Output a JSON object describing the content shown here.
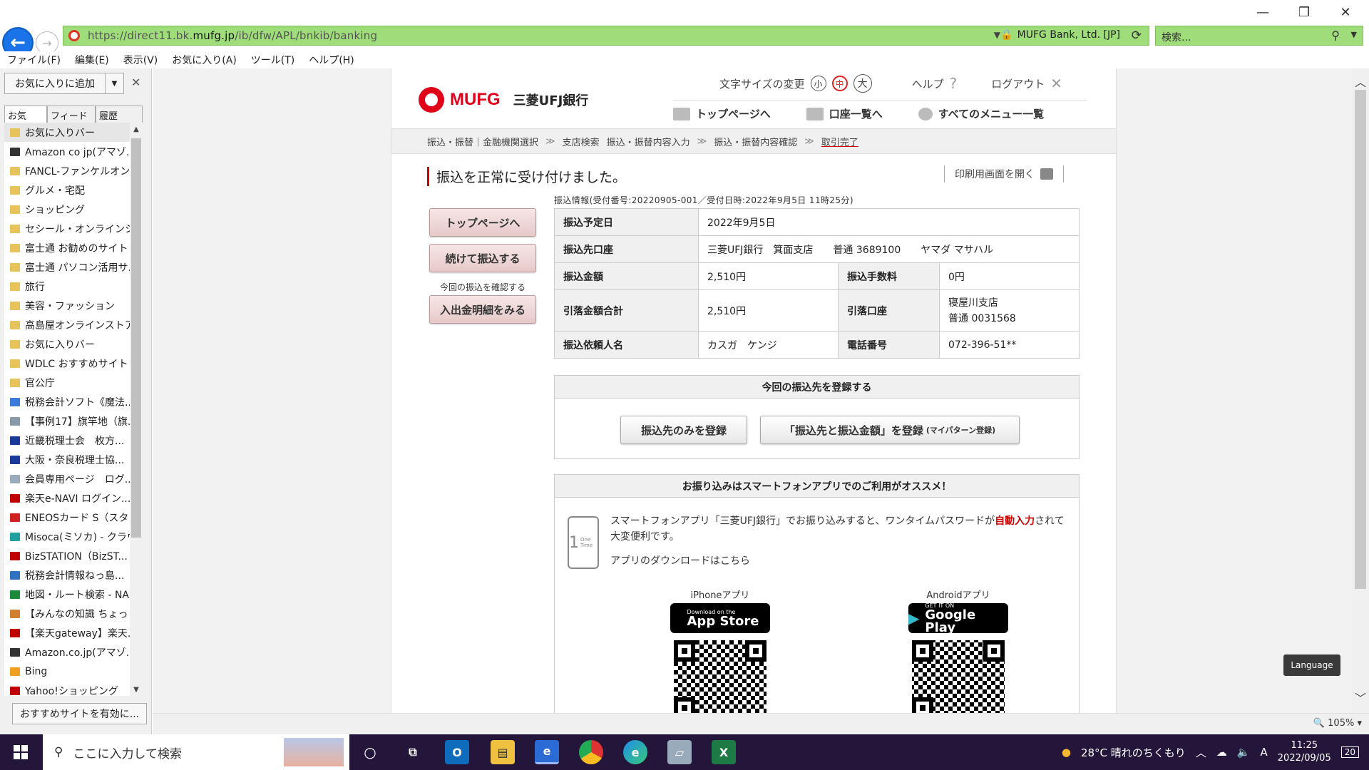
{
  "browser": {
    "url_prefix": "https://direct11.bk.",
    "url_domain": "mufg.jp",
    "url_path": "/ib/dfw/APL/bnkib/banking",
    "cert_label": "MUFG Bank, Ltd. [JP]",
    "search_placeholder": "検索...",
    "menu": [
      "ファイル(F)",
      "編集(E)",
      "表示(V)",
      "お気に入り(A)",
      "ツール(T)",
      "ヘルプ(H)"
    ]
  },
  "favorites": {
    "add_button": "お気に入りに追加",
    "tabs": [
      "お気に...",
      "フィード",
      "履歴"
    ],
    "items": [
      {
        "label": "お気に入りバー",
        "color": "#e8c25a"
      },
      {
        "label": "Amazon co jp(アマゾ...",
        "color": "#333333"
      },
      {
        "label": "FANCL-ファンケルオンラ...",
        "color": "#e8c25a"
      },
      {
        "label": "グルメ・宅配",
        "color": "#e8c25a"
      },
      {
        "label": "ショッピング",
        "color": "#e8c25a"
      },
      {
        "label": "セシール・オンラインショ...",
        "color": "#e8c25a"
      },
      {
        "label": "富士通 お勧めのサイト",
        "color": "#e8c25a"
      },
      {
        "label": "富士通 パソコン活用サ...",
        "color": "#e8c25a"
      },
      {
        "label": "旅行",
        "color": "#e8c25a"
      },
      {
        "label": "美容・ファッション",
        "color": "#e8c25a"
      },
      {
        "label": "高島屋オンラインストア",
        "color": "#e8c25a"
      },
      {
        "label": "お気に入りバー",
        "color": "#e8c25a"
      },
      {
        "label": "WDLC おすすめサイト",
        "color": "#e8c25a"
      },
      {
        "label": "官公庁",
        "color": "#e8c25a"
      },
      {
        "label": "税務会計ソフト《魔法...",
        "color": "#3a7ad8"
      },
      {
        "label": "【事例17】旗竿地（旗...",
        "color": "#8899aa"
      },
      {
        "label": "近畿税理士会　枚方...",
        "color": "#1a3a9a"
      },
      {
        "label": "大阪・奈良税理士協...",
        "color": "#1a3a9a"
      },
      {
        "label": "会員専用ページ　ログ...",
        "color": "#99aabb"
      },
      {
        "label": "楽天e-NAVI ログイン...",
        "color": "#c00000"
      },
      {
        "label": "ENEOSカード S（スタ...",
        "color": "#d02020"
      },
      {
        "label": "Misoca(ミソカ) - クラウ...",
        "color": "#20a0a0"
      },
      {
        "label": "BizSTATION（BizST...",
        "color": "#c00000"
      },
      {
        "label": "税務会計情報ねっ島...",
        "color": "#3070c0"
      },
      {
        "label": "地図・ルート検索 - NA...",
        "color": "#1a8a3a"
      },
      {
        "label": "【みんなの知識 ちょっと...",
        "color": "#d08030"
      },
      {
        "label": "【楽天gateway】楽天...",
        "color": "#c00000"
      },
      {
        "label": "Amazon.co.jp(アマゾ...",
        "color": "#333333"
      },
      {
        "label": "Bing",
        "color": "#f0a020"
      },
      {
        "label": "Yahoo!ショッピング",
        "color": "#c00000"
      }
    ],
    "enable_button": "おすすめサイトを有効に..."
  },
  "site": {
    "logo_text": "MUFG",
    "bank_name": "三菱UFJ銀行",
    "text_size_label": "文字サイズの変更",
    "size_options": [
      "小",
      "中",
      "大"
    ],
    "help_label": "ヘルプ",
    "logout_label": "ログアウト",
    "nav": [
      "トップページへ",
      "口座一覧へ",
      "すべてのメニュー一覧"
    ],
    "breadcrumb": [
      "振込・振替｜金融機関選択",
      "支店検索",
      "振込・振替内容入力",
      "振込・振替内容確認",
      "取引完了"
    ],
    "headline": "振込を正常に受け付けました。",
    "print_link": "印刷用画面を開く",
    "ref_info": "振込情報(受付番号:20220905-001／受付日時:2022年9月5日 11時25分)",
    "side_buttons": {
      "top": "トップページへ",
      "continue": "続けて振込する",
      "confirm_label": "今回の振込を確認する",
      "statement": "入出金明細をみる"
    },
    "details": {
      "scheduled_label": "振込予定日",
      "scheduled_value": "2022年9月5日",
      "dest_label": "振込先口座",
      "dest_value": "三菱UFJ銀行　箕面支店　　普通 3689100　　ヤマダ マサハル",
      "amount_label": "振込金額",
      "amount_value": "2,510円",
      "fee_label": "振込手数料",
      "fee_value": "0円",
      "total_label": "引落金額合計",
      "total_value": "2,510円",
      "debit_label": "引落口座",
      "debit_value1": "寝屋川支店",
      "debit_value2": "普通 0031568",
      "requester_label": "振込依頼人名",
      "requester_value": "カスガ　ケンジ",
      "phone_label": "電話番号",
      "phone_value": "072-396-51**"
    },
    "register": {
      "title": "今回の振込先を登録する",
      "btn_dest_only": "振込先のみを登録",
      "btn_dest_amount": "「振込先と振込金額」を登録",
      "btn_dest_amount_small": "(マイパターン登録)"
    },
    "app": {
      "title": "お振り込みはスマートフォンアプリでのご利用がオススメ！",
      "text1": "スマートフォンアプリ「三菱UFJ銀行」でお振り込みすると、ワンタイムパスワードが",
      "text_red": "自動入力",
      "text2": "されて大変便利です。",
      "download": "アプリのダウンロードはこちら",
      "iphone_label": "iPhoneアプリ",
      "android_label": "Androidアプリ",
      "appstore_small": "Download on the",
      "appstore_big": "App Store",
      "gplay_small": "GET IT ON",
      "gplay_big": "Google Play",
      "phone_icon_text": "1",
      "phone_icon_sub": "One Time"
    },
    "language_button": "Language"
  },
  "status": {
    "zoom": "105%"
  },
  "taskbar": {
    "search_placeholder": "ここに入力して検索",
    "weather": "28°C  晴れのちくもり",
    "time": "11:25",
    "date": "2022/09/05",
    "notifications": "20"
  }
}
